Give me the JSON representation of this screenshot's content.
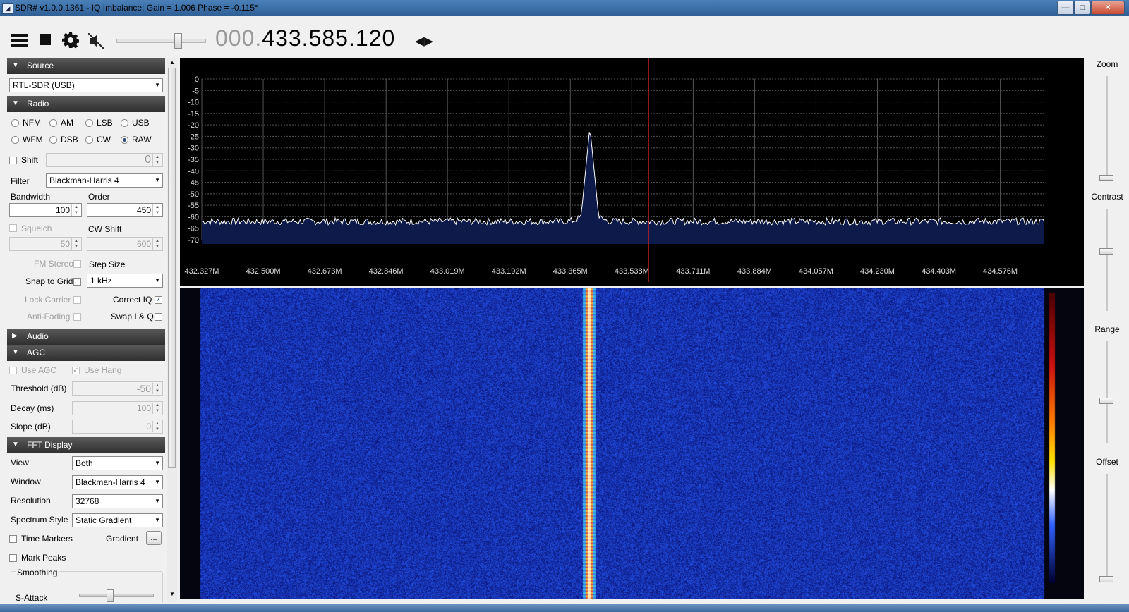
{
  "window": {
    "title": "SDR# v1.0.0.1361 - IQ Imbalance: Gain = 1.006 Phase = -0.115°",
    "minimize": "—",
    "maximize": "□",
    "close": "✕",
    "app_icon": "sdr-icon"
  },
  "toolbar": {
    "menu_icon": "hamburger-menu-icon",
    "stop_icon": "stop-icon",
    "settings_icon": "gear-icon",
    "mute_icon": "speaker-muted-icon",
    "volume_level": 0.7,
    "frequency_prefix": "000.",
    "frequency_main": "433.585.120",
    "tune_arrows": "◂▸"
  },
  "sections": {
    "source": "Source",
    "radio": "Radio",
    "audio": "Audio",
    "agc": "AGC",
    "fft_display": "FFT Display"
  },
  "source": {
    "device": "RTL-SDR (USB)"
  },
  "radio": {
    "modes": [
      "NFM",
      "AM",
      "LSB",
      "USB",
      "WFM",
      "DSB",
      "CW",
      "RAW"
    ],
    "selected_mode": "RAW",
    "shift_label": "Shift",
    "shift_value": "0",
    "filter_label": "Filter",
    "filter_value": "Blackman-Harris 4",
    "bandwidth_label": "Bandwidth",
    "bandwidth_value": "100",
    "order_label": "Order",
    "order_value": "450",
    "squelch_label": "Squelch",
    "squelch_value": "50",
    "cw_shift_label": "CW Shift",
    "cw_shift_value": "600",
    "fm_stereo_label": "FM Stereo",
    "step_size_label": "Step Size",
    "snap_label": "Snap to Grid",
    "snap_value": "1 kHz",
    "lock_carrier_label": "Lock Carrier",
    "correct_iq_label": "Correct IQ",
    "anti_fading_label": "Anti-Fading",
    "swap_iq_label": "Swap I & Q"
  },
  "agc": {
    "use_agc_label": "Use AGC",
    "use_hang_label": "Use Hang",
    "threshold_label": "Threshold (dB)",
    "threshold_value": "-50",
    "decay_label": "Decay (ms)",
    "decay_value": "100",
    "slope_label": "Slope (dB)",
    "slope_value": "0"
  },
  "fft": {
    "view_label": "View",
    "view_value": "Both",
    "window_label": "Window",
    "window_value": "Blackman-Harris 4",
    "resolution_label": "Resolution",
    "resolution_value": "32768",
    "spectrum_style_label": "Spectrum Style",
    "spectrum_style_value": "Static Gradient",
    "time_markers_label": "Time Markers",
    "gradient_label": "Gradient",
    "gradient_button": "...",
    "mark_peaks_label": "Mark Peaks",
    "smoothing_label": "Smoothing",
    "s_attack_label": "S-Attack"
  },
  "right_panel": {
    "zoom_label": "Zoom",
    "contrast_label": "Contrast",
    "range_label": "Range",
    "offset_label": "Offset"
  },
  "colors": {
    "spectrum_bg": "#000000",
    "trace": "#ffffff",
    "fill": "#0d1a4a",
    "cursor": "#cc2222",
    "waterfall_bg": "#14209a"
  },
  "chart_data": {
    "type": "line",
    "title": "",
    "xlabel": "",
    "ylabel": "",
    "y_ticks": [
      "0",
      "-5",
      "-10",
      "-15",
      "-20",
      "-25",
      "-30",
      "-35",
      "-40",
      "-45",
      "-50",
      "-55",
      "-60",
      "-65",
      "-70"
    ],
    "x_ticks": [
      "432.327M",
      "432.500M",
      "432.673M",
      "432.846M",
      "433.019M",
      "433.192M",
      "433.365M",
      "433.538M",
      "433.711M",
      "433.884M",
      "434.057M",
      "434.230M",
      "434.403M",
      "434.576M"
    ],
    "xlim": [
      432.327,
      434.7
    ],
    "ylim": [
      -70,
      0
    ],
    "grid": true,
    "center_marker_mhz": 433.585,
    "noise_floor_db": -62,
    "peak": {
      "x_mhz": 433.42,
      "y_db": -25
    },
    "series": [
      {
        "values": []
      }
    ]
  }
}
